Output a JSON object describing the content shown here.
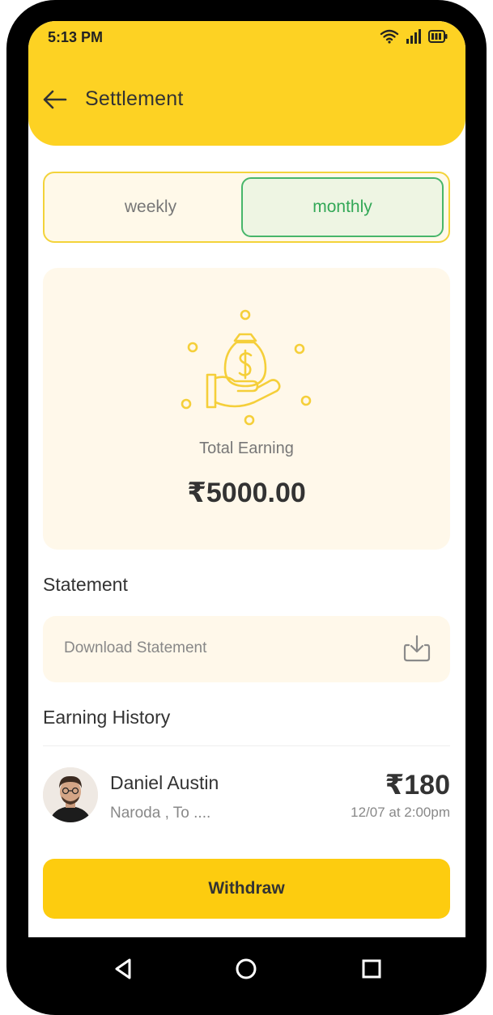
{
  "status_bar": {
    "time": "5:13 PM"
  },
  "header": {
    "title": "Settlement"
  },
  "period_toggle": {
    "options": [
      "weekly",
      "monthly"
    ],
    "selected": "monthly"
  },
  "earning_card": {
    "label": "Total Earning",
    "amount": "₹5000.00"
  },
  "statement": {
    "section_title": "Statement",
    "download_label": "Download Statement"
  },
  "earning_history": {
    "section_title": "Earning History",
    "items": [
      {
        "name": "Daniel Austin",
        "location": "Naroda , To ....",
        "amount": "₹180",
        "datetime": "12/07 at 2:00pm"
      }
    ]
  },
  "actions": {
    "withdraw_label": "Withdraw"
  },
  "colors": {
    "header": "#fdd223",
    "accent": "#fdcc0f",
    "active_tab": "#33a857",
    "card_bg": "#fff8ea"
  },
  "icons": [
    "back-arrow-icon",
    "wifi-icon",
    "signal-icon",
    "battery-icon",
    "money-bag-hand-icon",
    "download-icon",
    "nav-back-icon",
    "nav-home-icon",
    "nav-recent-icon"
  ]
}
